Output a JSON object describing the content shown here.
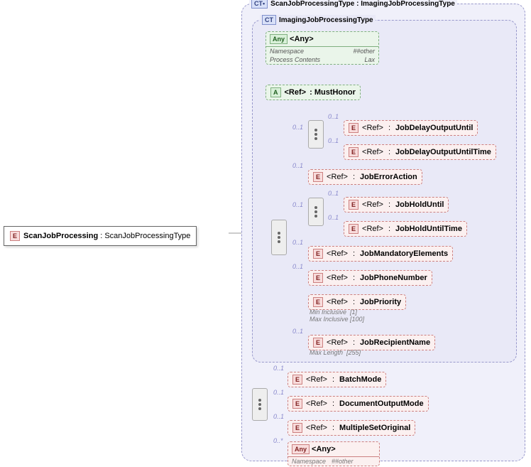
{
  "root": {
    "name": "ScanJobProcessing",
    "type": "ScanJobProcessingType"
  },
  "outer": {
    "name": "ScanJobProcessingType",
    "base": "ImagingJobProcessingType"
  },
  "inner": {
    "name": "ImagingJobProcessingType"
  },
  "anyBox": {
    "label": "<Any>",
    "nsKey": "Namespace",
    "nsVal": "##other",
    "pcKey": "Process Contents",
    "pcVal": "Lax"
  },
  "mustHonor": {
    "ref": "<Ref>",
    "name": "MustHonor"
  },
  "inner_refs": {
    "jobDelayOutputUntil": "JobDelayOutputUntil",
    "jobDelayOutputUntilTime": "JobDelayOutputUntilTime",
    "jobErrorAction": "JobErrorAction",
    "jobHoldUntil": "JobHoldUntil",
    "jobHoldUntilTime": "JobHoldUntilTime",
    "jobMandatoryElements": "JobMandatoryElements",
    "jobPhoneNumber": "JobPhoneNumber",
    "jobPriority": "JobPriority",
    "jobRecipientName": "JobRecipientName"
  },
  "jobPriorityConstraints": {
    "minKey": "Min Inclusive",
    "minVal": "[1]",
    "maxKey": "Max Inclusive",
    "maxVal": "[100]"
  },
  "jobRecipientConstraints": {
    "maxLenKey": "Max Length",
    "maxLenVal": "[255]"
  },
  "outer_refs": {
    "batchMode": "BatchMode",
    "documentOutputMode": "DocumentOutputMode",
    "multipleSetOriginal": "MultipleSetOriginal"
  },
  "anyPink": {
    "label": "<Any>",
    "nsKey": "Namespace",
    "nsVal": "##other"
  },
  "labels": {
    "ref": "<Ref>",
    "E": "E",
    "A": "A",
    "Any": "Any",
    "CT": "CT",
    "CTplus": "CT•"
  },
  "occ": {
    "opt": "0..1",
    "many": "0..*"
  }
}
